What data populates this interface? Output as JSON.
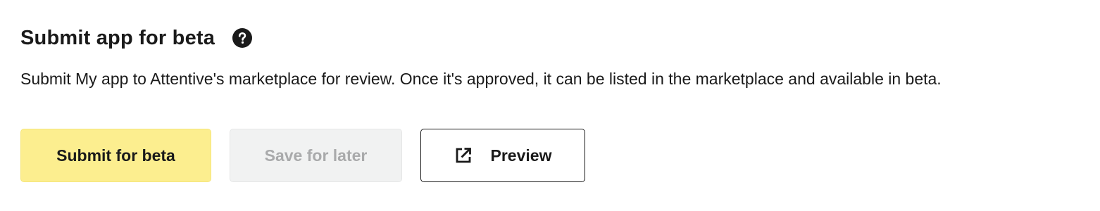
{
  "section": {
    "title": "Submit app for beta",
    "help_icon": "question-circle-icon",
    "description": "Submit My app to Attentive's marketplace for review. Once it's approved, it can be listed in the marketplace and available in beta."
  },
  "actions": {
    "submit_label": "Submit for beta",
    "save_label": "Save for later",
    "save_disabled": true,
    "preview_label": "Preview",
    "preview_icon": "external-link-icon"
  },
  "colors": {
    "primary_button_bg": "#fcee8f",
    "disabled_button_bg": "#f1f2f2",
    "disabled_button_text": "#a9aaab",
    "text": "#1a1a1a"
  }
}
